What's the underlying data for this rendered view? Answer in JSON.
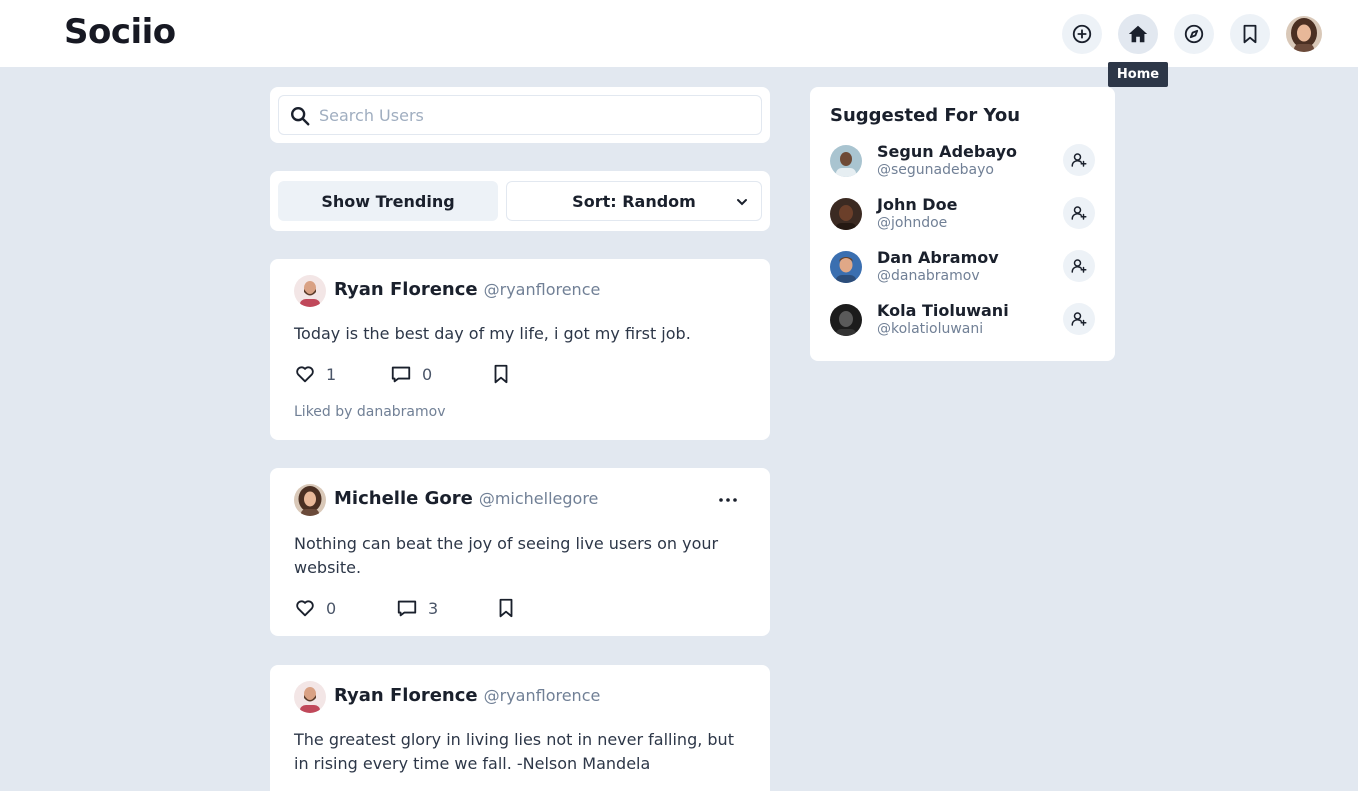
{
  "app": {
    "logo": "Sociio"
  },
  "nav": {
    "tooltip": "Home",
    "items": [
      {
        "icon": "plus-circle-icon"
      },
      {
        "icon": "home-icon",
        "active": true
      },
      {
        "icon": "compass-icon"
      },
      {
        "icon": "bookmark-icon"
      },
      {
        "icon": "user-avatar"
      }
    ]
  },
  "search": {
    "placeholder": "Search Users",
    "value": ""
  },
  "filters": {
    "trending_label": "Show Trending",
    "sort_label": "Sort: Random"
  },
  "posts": [
    {
      "name": "Ryan Florence",
      "handle": "@ryanflorence",
      "text": "Today is the best day of my life, i got my first job.",
      "likes": "1",
      "comments": "0",
      "liked_by": "Liked by danabramov"
    },
    {
      "name": "Michelle Gore",
      "handle": "@michellegore",
      "text": "Nothing can beat the joy of seeing live users on your website.",
      "likes": "0",
      "comments": "3"
    },
    {
      "name": "Ryan Florence",
      "handle": "@ryanflorence",
      "text": "The greatest glory in living lies not in never falling, but in rising every time we fall. -Nelson Mandela"
    }
  ],
  "suggestions": {
    "title": "Suggested For You",
    "users": [
      {
        "name": "Segun Adebayo",
        "handle": "@segunadebayo"
      },
      {
        "name": "John Doe",
        "handle": "@johndoe"
      },
      {
        "name": "Dan Abramov",
        "handle": "@danabramov"
      },
      {
        "name": "Kola Tioluwani",
        "handle": "@kolatioluwani"
      }
    ]
  },
  "colors": {
    "background": "#e2e8f0",
    "card": "#ffffff",
    "button_bg": "#edf2f7",
    "tooltip_bg": "#2d3748",
    "muted_text": "#718096"
  }
}
